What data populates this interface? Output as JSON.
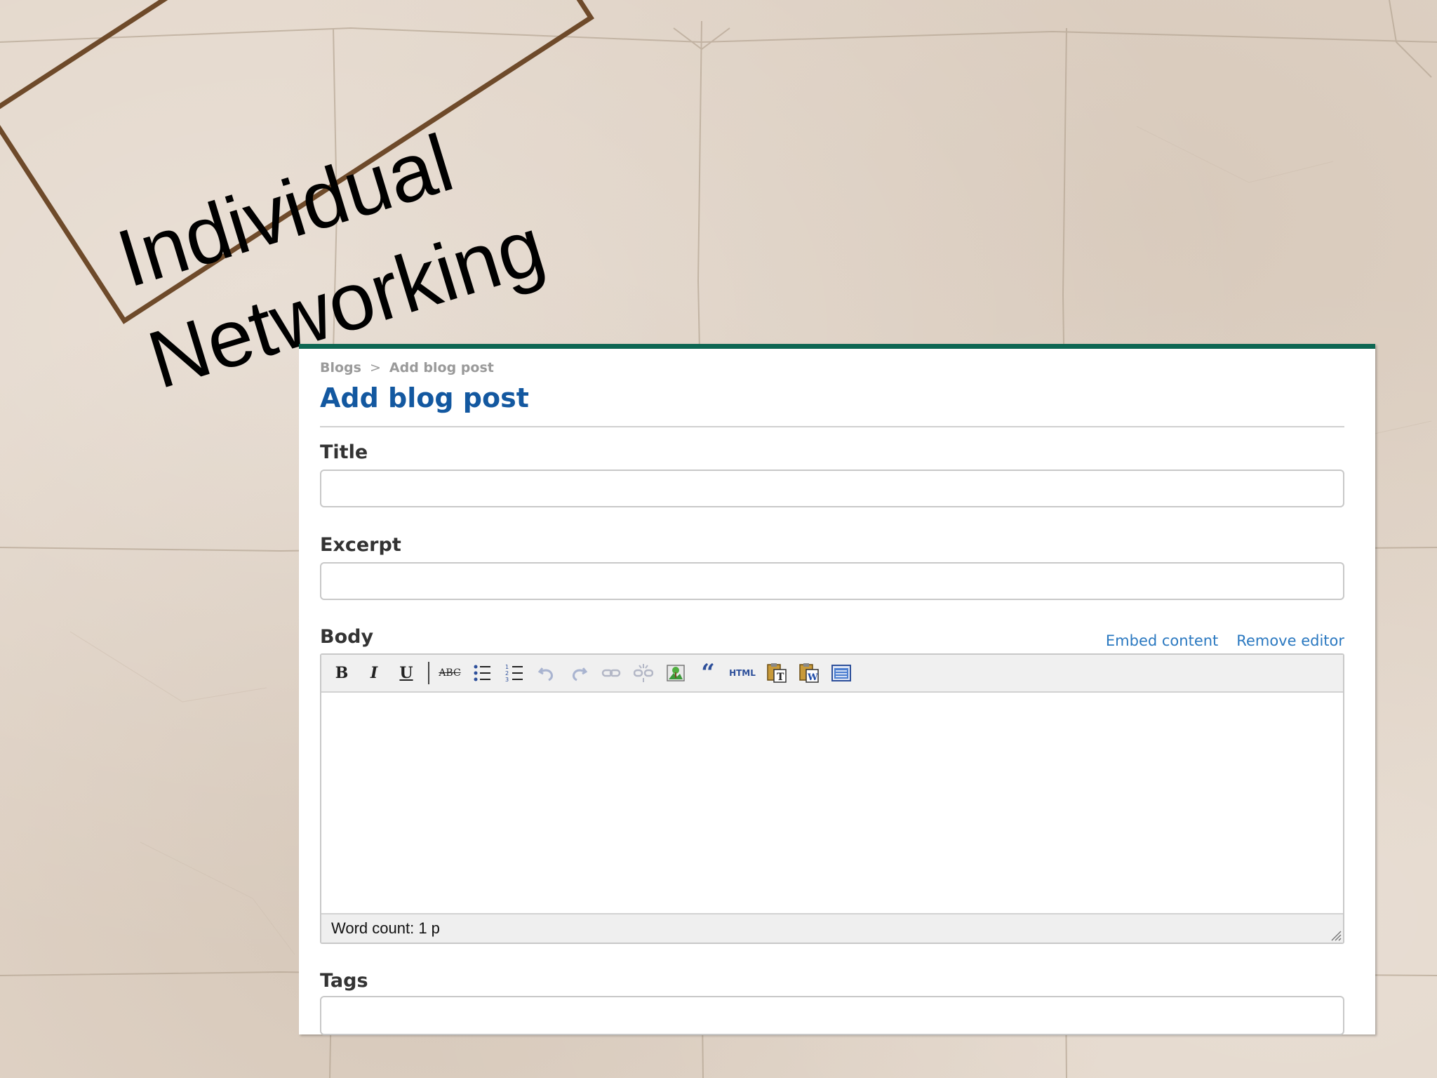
{
  "slide": {
    "title_line1": "Individual",
    "title_line2": "Networking"
  },
  "breadcrumb": {
    "root": "Blogs",
    "separator": ">",
    "current": "Add blog post"
  },
  "page_title": "Add blog post",
  "form": {
    "title_label": "Title",
    "title_value": "",
    "excerpt_label": "Excerpt",
    "excerpt_value": "",
    "body_label": "Body",
    "embed_link": "Embed content",
    "remove_editor_link": "Remove editor",
    "tags_label": "Tags",
    "tags_value": ""
  },
  "toolbar": {
    "bold": "B",
    "italic": "I",
    "underline": "U",
    "strike": "ABC",
    "html": "HTML",
    "buttons": [
      "bold-icon",
      "italic-icon",
      "underline-icon",
      "strikethrough-icon",
      "bullet-list-icon",
      "numbered-list-icon",
      "undo-icon",
      "redo-icon",
      "link-icon",
      "unlink-icon",
      "image-icon",
      "blockquote-icon",
      "html-icon",
      "paste-text-icon",
      "paste-word-icon",
      "fullscreen-icon"
    ]
  },
  "editor": {
    "status": "Word count: 1 p"
  },
  "colors": {
    "accent": "#0d6652",
    "title": "#1358a0",
    "link": "#2a78c0",
    "stamp": "#6e4a2a"
  }
}
